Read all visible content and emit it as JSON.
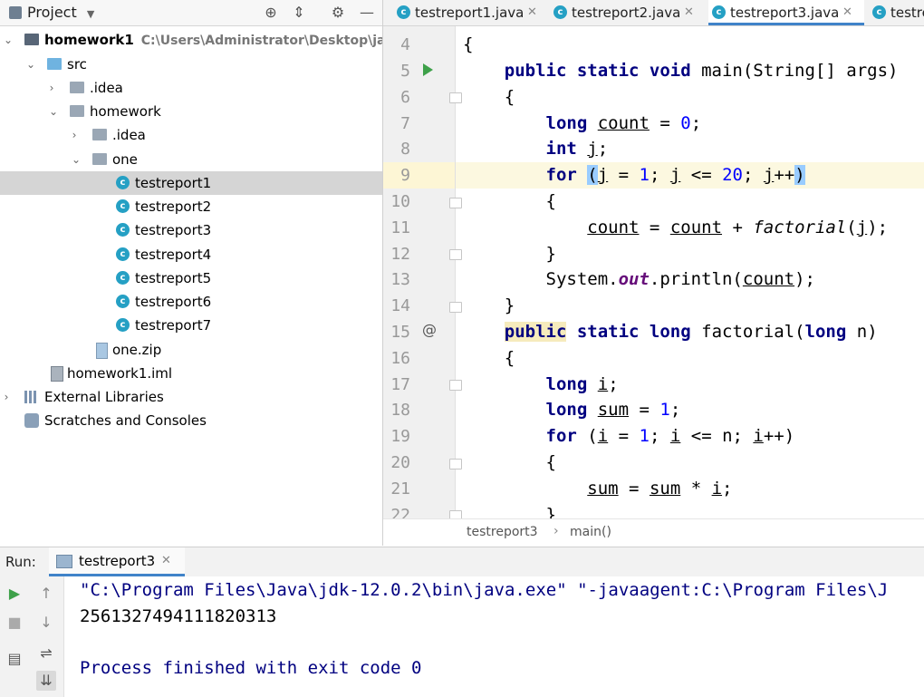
{
  "project_panel": {
    "title": "Project",
    "tree": [
      {
        "label": "homework1",
        "path": "C:\\Users\\Administrator\\Desktop\\java\\",
        "icon": "module-folder-icon"
      },
      {
        "label": "src",
        "icon": "source-folder-icon"
      },
      {
        "label": ".idea",
        "icon": "folder-icon"
      },
      {
        "label": "homework",
        "icon": "package-folder-icon"
      },
      {
        "label": ".idea",
        "icon": "folder-icon"
      },
      {
        "label": "one",
        "icon": "package-folder-icon"
      },
      {
        "label": "testreport1",
        "icon": "java-class-icon"
      },
      {
        "label": "testreport2",
        "icon": "java-class-icon"
      },
      {
        "label": "testreport3",
        "icon": "java-class-icon"
      },
      {
        "label": "testreport4",
        "icon": "java-class-icon"
      },
      {
        "label": "testreport5",
        "icon": "java-class-icon"
      },
      {
        "label": "testreport6",
        "icon": "java-class-icon"
      },
      {
        "label": "testreport7",
        "icon": "java-class-icon"
      },
      {
        "label": "one.zip",
        "icon": "zip-file-icon"
      },
      {
        "label": "homework1.iml",
        "icon": "iml-file-icon"
      },
      {
        "label": "External Libraries",
        "icon": "libraries-icon"
      },
      {
        "label": "Scratches and Consoles",
        "icon": "scratches-icon"
      }
    ]
  },
  "editor_tabs": [
    {
      "label": "testreport1.java",
      "active": false
    },
    {
      "label": "testreport2.java",
      "active": false
    },
    {
      "label": "testreport3.java",
      "active": true
    },
    {
      "label": "testre",
      "active": false
    }
  ],
  "editor": {
    "line_numbers": [
      "4",
      "5",
      "6",
      "7",
      "8",
      "9",
      "10",
      "11",
      "12",
      "13",
      "14",
      "15",
      "16",
      "17",
      "18",
      "19",
      "20",
      "21",
      "22"
    ]
  },
  "breadcrumb": {
    "file": "testreport3",
    "method": "main()"
  },
  "run_panel": {
    "label": "Run:",
    "tab": "testreport3",
    "console": [
      "\"C:\\Program Files\\Java\\jdk-12.0.2\\bin\\java.exe\" \"-javaagent:C:\\Program Files\\J",
      "2561327494111820313",
      "",
      "Process finished with exit code 0"
    ]
  },
  "colors": {
    "keyword": "#000080",
    "number": "#0000ff",
    "field": "#660e7a",
    "accent": "#4083c9",
    "run_green": "#3ea14a"
  }
}
